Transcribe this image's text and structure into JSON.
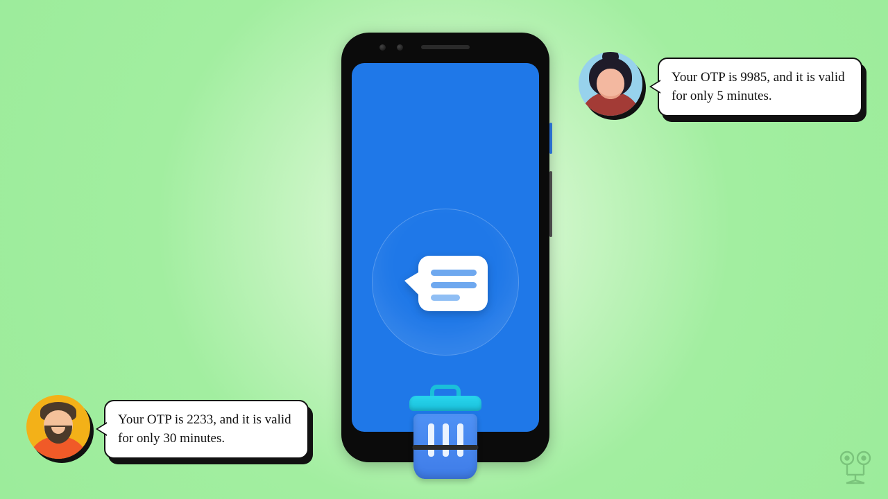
{
  "bubbles": {
    "top": {
      "text": "Your OTP is 9985, and it is valid for only 5 minutes."
    },
    "bottom": {
      "text": "Your OTP is 2233, and it is valid for only 30 minutes."
    }
  },
  "avatars": {
    "top": {
      "name": "woman-avatar",
      "bg": "#97d2ec"
    },
    "bottom": {
      "name": "man-avatar",
      "bg": "#f3b118"
    }
  },
  "phone": {
    "screen_bg": "#1f78e8",
    "icons": {
      "chat": "chat-bubble-icon",
      "trash": "trash-can-icon"
    }
  },
  "watermark": {
    "label": "logo"
  }
}
